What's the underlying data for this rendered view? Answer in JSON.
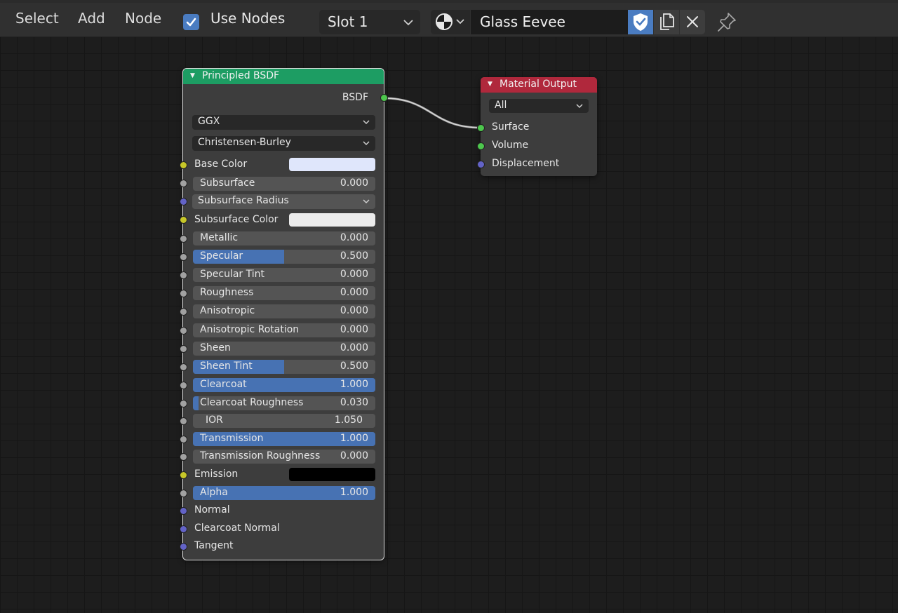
{
  "header": {
    "menu": [
      "Select",
      "Add",
      "Node"
    ],
    "use_nodes_label": "Use Nodes",
    "use_nodes_checked": true,
    "slot": "Slot 1",
    "material_name": "Glass Eevee"
  },
  "bsdf_node": {
    "title": "Principled BSDF",
    "output_label": "BSDF",
    "distribution": "GGX",
    "subsurface_method": "Christensen-Burley",
    "base_color_label": "Base Color",
    "base_color": "#dfe6fb",
    "subsurface": {
      "label": "Subsurface",
      "value": "0.000",
      "fraction": 0.0
    },
    "subsurface_radius": "Subsurface Radius",
    "subsurface_color_label": "Subsurface Color",
    "subsurface_color": "#ebebeb",
    "metallic": {
      "label": "Metallic",
      "value": "0.000",
      "fraction": 0.0
    },
    "specular": {
      "label": "Specular",
      "value": "0.500",
      "fraction": 0.5
    },
    "specular_tint": {
      "label": "Specular Tint",
      "value": "0.000",
      "fraction": 0.0
    },
    "roughness": {
      "label": "Roughness",
      "value": "0.000",
      "fraction": 0.0
    },
    "anisotropic": {
      "label": "Anisotropic",
      "value": "0.000",
      "fraction": 0.0
    },
    "anisotropic_rotation": {
      "label": "Anisotropic Rotation",
      "value": "0.000",
      "fraction": 0.0
    },
    "sheen": {
      "label": "Sheen",
      "value": "0.000",
      "fraction": 0.0
    },
    "sheen_tint": {
      "label": "Sheen Tint",
      "value": "0.500",
      "fraction": 0.5
    },
    "clearcoat": {
      "label": "Clearcoat",
      "value": "1.000",
      "fraction": 1.0
    },
    "clearcoat_roughness": {
      "label": "Clearcoat Roughness",
      "value": "0.030",
      "fraction": 0.03
    },
    "ior": {
      "label": "IOR",
      "value": "1.050"
    },
    "transmission": {
      "label": "Transmission",
      "value": "1.000",
      "fraction": 1.0
    },
    "transmission_roughness": {
      "label": "Transmission Roughness",
      "value": "0.000",
      "fraction": 0.0
    },
    "emission_label": "Emission",
    "emission_color": "#000000",
    "alpha": {
      "label": "Alpha",
      "value": "1.000",
      "fraction": 1.0
    },
    "normal_label": "Normal",
    "clearcoat_normal_label": "Clearcoat Normal",
    "tangent_label": "Tangent"
  },
  "output_node": {
    "title": "Material Output",
    "target": "All",
    "surface_label": "Surface",
    "volume_label": "Volume",
    "displacement_label": "Displacement"
  },
  "colors": {
    "bsdf_header": "#1d9d63",
    "output_header": "#b0283c",
    "slider_fill": "#4772b3",
    "accent_blue": "#4a7cc1"
  }
}
